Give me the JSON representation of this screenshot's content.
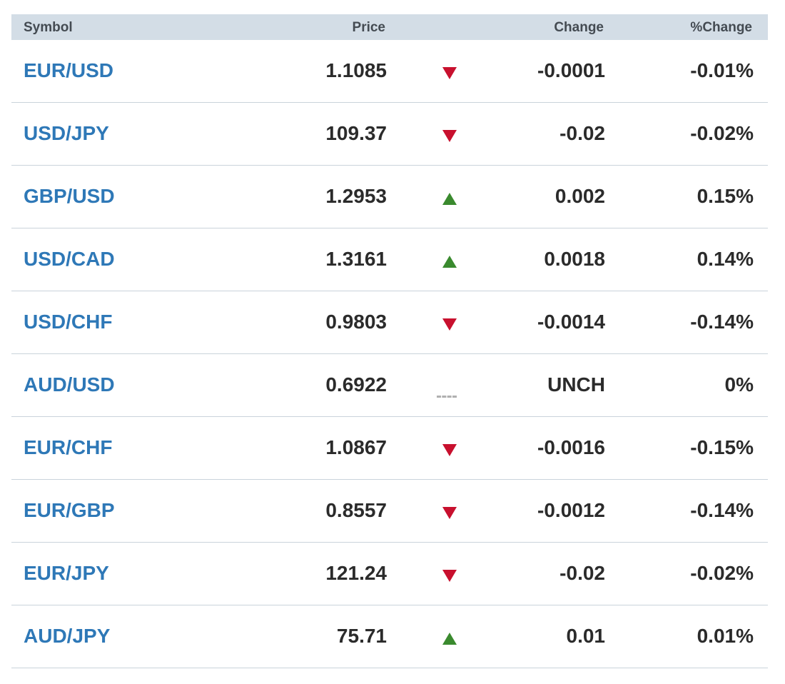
{
  "columns": {
    "symbol": "Symbol",
    "price": "Price",
    "change": "Change",
    "pct_change": "%Change"
  },
  "colors": {
    "header_bg": "#d3dde6",
    "symbol_link": "#2e78b7",
    "down": "#c8102e",
    "up": "#3a8a2e",
    "unchanged": "#b0b0b0"
  },
  "rows": [
    {
      "symbol": "EUR/USD",
      "price": "1.1085",
      "direction": "down",
      "change": "-0.0001",
      "pct_change": "-0.01%"
    },
    {
      "symbol": "USD/JPY",
      "price": "109.37",
      "direction": "down",
      "change": "-0.02",
      "pct_change": "-0.02%"
    },
    {
      "symbol": "GBP/USD",
      "price": "1.2953",
      "direction": "up",
      "change": "0.002",
      "pct_change": "0.15%"
    },
    {
      "symbol": "USD/CAD",
      "price": "1.3161",
      "direction": "up",
      "change": "0.0018",
      "pct_change": "0.14%"
    },
    {
      "symbol": "USD/CHF",
      "price": "0.9803",
      "direction": "down",
      "change": "-0.0014",
      "pct_change": "-0.14%"
    },
    {
      "symbol": "AUD/USD",
      "price": "0.6922",
      "direction": "flat",
      "change": "UNCH",
      "pct_change": "0%"
    },
    {
      "symbol": "EUR/CHF",
      "price": "1.0867",
      "direction": "down",
      "change": "-0.0016",
      "pct_change": "-0.15%"
    },
    {
      "symbol": "EUR/GBP",
      "price": "0.8557",
      "direction": "down",
      "change": "-0.0012",
      "pct_change": "-0.14%"
    },
    {
      "symbol": "EUR/JPY",
      "price": "121.24",
      "direction": "down",
      "change": "-0.02",
      "pct_change": "-0.02%"
    },
    {
      "symbol": "AUD/JPY",
      "price": "75.71",
      "direction": "up",
      "change": "0.01",
      "pct_change": "0.01%"
    }
  ]
}
